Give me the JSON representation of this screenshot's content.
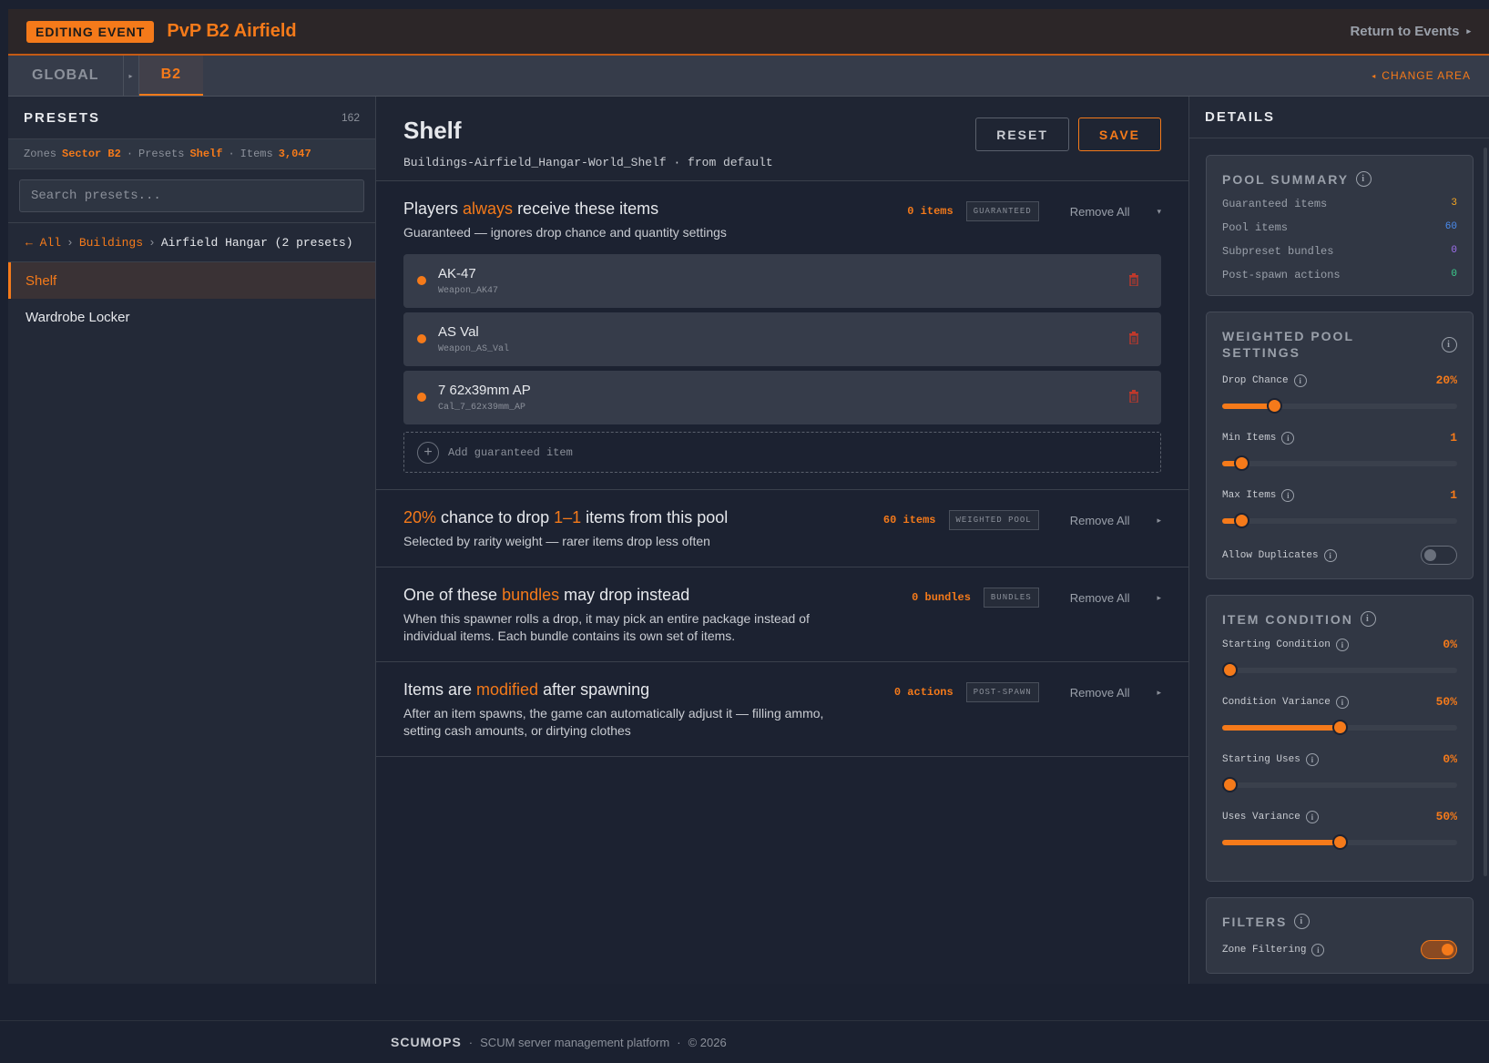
{
  "header": {
    "badge": "EDITING EVENT",
    "event_title": "PvP B2 Airfield",
    "return_label": "Return to Events",
    "return_arrow": "▸"
  },
  "areabar": {
    "tabs": [
      {
        "label": "GLOBAL"
      },
      {
        "label": "B2"
      }
    ],
    "separator": "▸",
    "change_area": "CHANGE AREA",
    "change_area_arrow": "◂"
  },
  "presets": {
    "title": "PRESETS",
    "count": "162",
    "stats": {
      "zones_label": "Zones",
      "zones_value": "Sector B2",
      "presets_label": "Presets",
      "presets_value": "Shelf",
      "items_label": "Items",
      "items_value": "3,047",
      "dot": "·"
    },
    "search_placeholder": "Search presets...",
    "breadcrumb": {
      "all": "← All",
      "sep": "›",
      "category": "Buildings",
      "current": "Airfield Hangar (2 presets)"
    },
    "list": [
      {
        "label": "Shelf",
        "active": true
      },
      {
        "label": "Wardrobe Locker",
        "active": false
      }
    ]
  },
  "editor": {
    "title": "Shelf",
    "subtitle": "Buildings-Airfield_Hangar-World_Shelf · from default",
    "reset_label": "RESET",
    "save_label": "SAVE",
    "remove_all": "Remove All",
    "guaranteed": {
      "title_pre": "Players ",
      "title_hl": "always",
      "title_post": " receive these items",
      "desc": "Guaranteed — ignores drop chance and quantity settings",
      "count": "0 items",
      "tag": "GUARANTEED",
      "caret": "▾",
      "items": [
        {
          "name": "AK-47",
          "id": "Weapon_AK47"
        },
        {
          "name": "AS Val",
          "id": "Weapon_AS_Val"
        },
        {
          "name": "7 62x39mm AP",
          "id": "Cal_7_62x39mm_AP"
        }
      ],
      "add_label": "Add guaranteed item",
      "add_icon": "+"
    },
    "pool": {
      "title_hl1": "20%",
      "title_mid1": " chance to drop ",
      "title_hl2": "1–1",
      "title_post": " items from this pool",
      "desc": "Selected by rarity weight — rarer items drop less often",
      "count": "60 items",
      "tag": "WEIGHTED POOL",
      "caret": "▸"
    },
    "bundles": {
      "title_pre": "One of these ",
      "title_hl": "bundles",
      "title_post": " may drop instead",
      "desc": "When this spawner rolls a drop, it may pick an entire package instead of individual items. Each bundle contains its own set of items.",
      "count": "0 bundles",
      "tag": "BUNDLES",
      "caret": "▸"
    },
    "postspawn": {
      "title_pre": "Items are ",
      "title_hl": "modified",
      "title_post": " after spawning",
      "desc": "After an item spawns, the game can automatically adjust it — filling ammo, setting cash amounts, or dirtying clothes",
      "count": "0 actions",
      "tag": "POST-SPAWN",
      "caret": "▸"
    }
  },
  "details": {
    "title": "DETAILS",
    "info_glyph": "i",
    "pool_summary": {
      "title": "POOL SUMMARY",
      "rows": [
        {
          "label": "Guaranteed items",
          "value": "3",
          "color": "#f5a623"
        },
        {
          "label": "Pool items",
          "value": "60",
          "color": "#4a8cf0"
        },
        {
          "label": "Subpreset bundles",
          "value": "0",
          "color": "#a070f0"
        },
        {
          "label": "Post-spawn actions",
          "value": "0",
          "color": "#3ccf8e"
        }
      ]
    },
    "weighted": {
      "title": "WEIGHTED POOL SETTINGS",
      "drop_chance": {
        "label": "Drop Chance",
        "value": "20%",
        "fraction": 0.22
      },
      "min_items": {
        "label": "Min Items",
        "value": "1",
        "fraction": 0.08
      },
      "max_items": {
        "label": "Max Items",
        "value": "1",
        "fraction": 0.08
      },
      "allow_duplicates": {
        "label": "Allow Duplicates",
        "on": false
      }
    },
    "condition": {
      "title": "ITEM CONDITION",
      "starting_condition": {
        "label": "Starting Condition",
        "value": "0%",
        "fraction": 0.03
      },
      "condition_variance": {
        "label": "Condition Variance",
        "value": "50%",
        "fraction": 0.5
      },
      "starting_uses": {
        "label": "Starting Uses",
        "value": "0%",
        "fraction": 0.03
      },
      "uses_variance": {
        "label": "Uses Variance",
        "value": "50%",
        "fraction": 0.5
      }
    },
    "filters": {
      "title": "FILTERS",
      "zone_filtering": {
        "label": "Zone Filtering",
        "on": true
      }
    }
  },
  "footer": {
    "brand": "SCUMOPS",
    "dot": "·",
    "tagline": "SCUM server management platform",
    "copyright": "© 2026"
  }
}
